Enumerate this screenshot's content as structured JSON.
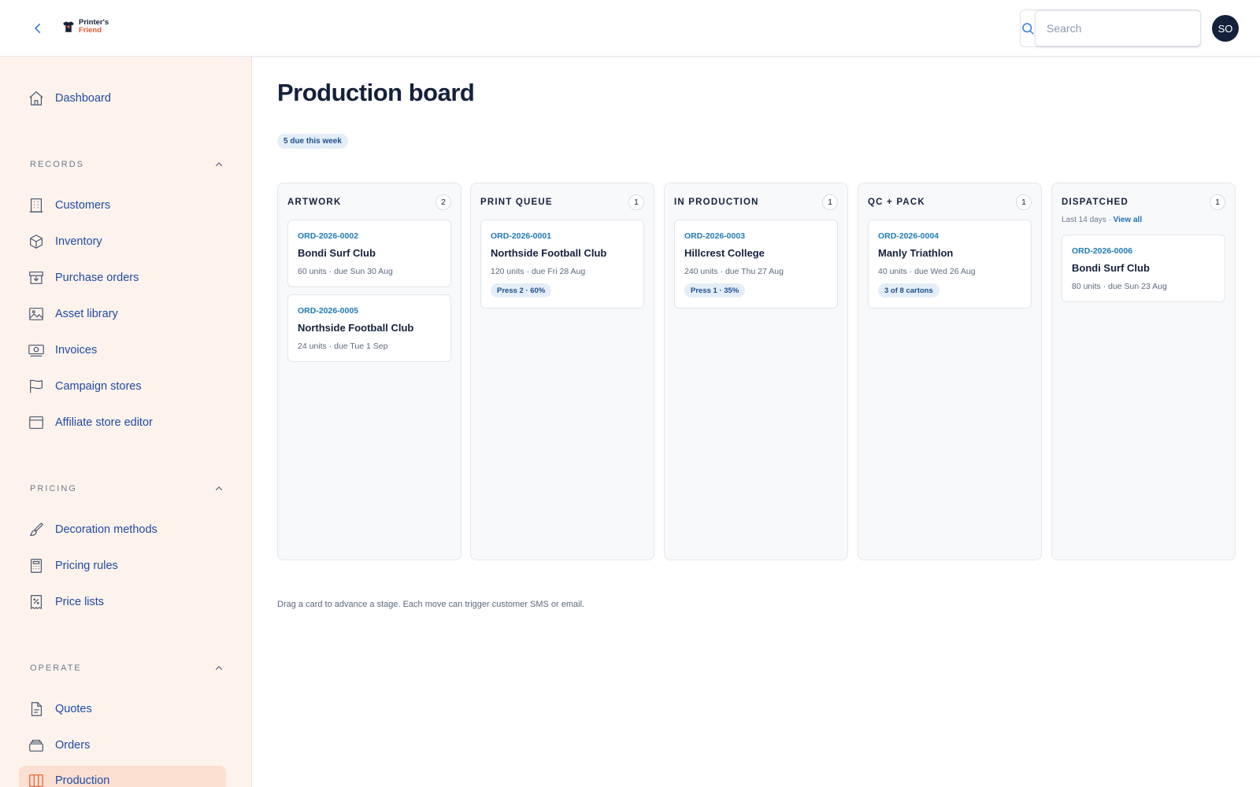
{
  "app": {
    "logo_line1": "Printer's",
    "logo_line2": "Friend",
    "accent": "#e4572e",
    "brand": "#14213d"
  },
  "header": {
    "search_placeholder": "Search",
    "avatar_initials": "SO"
  },
  "sidebar": {
    "dashboard": {
      "label": "Dashboard",
      "icon": "home-icon"
    },
    "sections": [
      {
        "title": "RECORDS",
        "items": [
          {
            "label": "Customers",
            "icon": "building-icon"
          },
          {
            "label": "Inventory",
            "icon": "box-icon"
          },
          {
            "label": "Purchase orders",
            "icon": "inbox-download-icon"
          },
          {
            "label": "Asset library",
            "icon": "image-icon"
          },
          {
            "label": "Invoices",
            "icon": "banknote-icon"
          },
          {
            "label": "Campaign stores",
            "icon": "flag-icon"
          },
          {
            "label": "Affiliate store editor",
            "icon": "browser-window-icon"
          }
        ]
      },
      {
        "title": "PRICING",
        "items": [
          {
            "label": "Decoration methods",
            "icon": "paintbrush-icon"
          },
          {
            "label": "Pricing rules",
            "icon": "calculator-icon"
          },
          {
            "label": "Price lists",
            "icon": "percent-receipt-icon"
          }
        ]
      },
      {
        "title": "OPERATE",
        "items": [
          {
            "label": "Quotes",
            "icon": "document-icon"
          },
          {
            "label": "Orders",
            "icon": "stack-icon"
          },
          {
            "label": "Production",
            "icon": "kanban-icon",
            "active": true
          }
        ]
      }
    ]
  },
  "main": {
    "title": "Production board",
    "due_badge": "5 due this week",
    "footnote": "Drag a card to advance a stage. Each move can trigger customer SMS or email.",
    "columns": [
      {
        "title": "ARTWORK",
        "count": "2",
        "cards": [
          {
            "order_id": "ORD-2026-0002",
            "customer": "Bondi Surf Club",
            "meta": "60 units · due Sun 30 Aug"
          },
          {
            "order_id": "ORD-2026-0005",
            "customer": "Northside Football Club",
            "meta": "24 units · due Tue 1 Sep"
          }
        ]
      },
      {
        "title": "PRINT QUEUE",
        "count": "1",
        "cards": [
          {
            "order_id": "ORD-2026-0001",
            "customer": "Northside Football Club",
            "meta": "120 units · due Fri 28 Aug",
            "tag": "Press 2 · 60%"
          }
        ]
      },
      {
        "title": "IN PRODUCTION",
        "count": "1",
        "cards": [
          {
            "order_id": "ORD-2026-0003",
            "customer": "Hillcrest College",
            "meta": "240 units · due Thu 27 Aug",
            "tag": "Press 1 · 35%"
          }
        ]
      },
      {
        "title": "QC + PACK",
        "count": "1",
        "cards": [
          {
            "order_id": "ORD-2026-0004",
            "customer": "Manly Triathlon",
            "meta": "40 units · due Wed 26 Aug",
            "tag": "3 of 8 cartons"
          }
        ]
      },
      {
        "title": "DISPATCHED",
        "count": "1",
        "subtitle": "Last 14 days · ",
        "subtitle_link": "View all",
        "cards": [
          {
            "order_id": "ORD-2026-0006",
            "customer": "Bondi Surf Club",
            "meta": "80 units · due Sun 23 Aug"
          }
        ]
      }
    ]
  }
}
